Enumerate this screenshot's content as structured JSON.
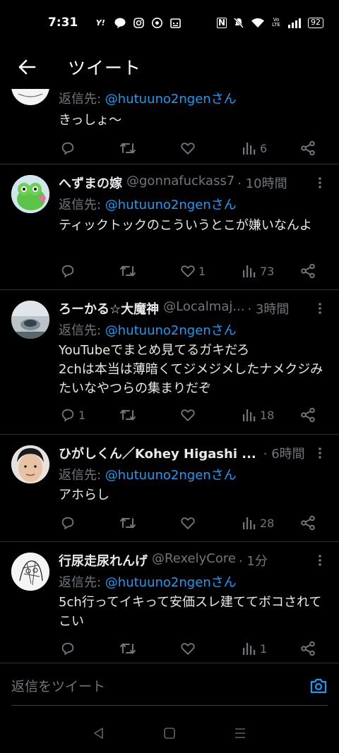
{
  "status_bar": {
    "time": "7:31",
    "battery": "92",
    "left_icons": [
      "yahoo-icon",
      "line-icon",
      "instagram-icon",
      "chrome-icon",
      "calendar-icon"
    ],
    "right_icons": [
      "nfc-icon",
      "mute-icon",
      "wifi-icon",
      "volte-icon",
      "signal-icon",
      "battery-icon"
    ]
  },
  "header": {
    "title": "ツイート"
  },
  "tweets": [
    {
      "name": "",
      "handle": "",
      "time": "",
      "reply_label": "返信先: ",
      "reply_mention": "@hutuuno2ngenさん",
      "text": "きっしょ〜",
      "replies": "",
      "retweets": "",
      "likes": "",
      "views": "6"
    },
    {
      "name": "へずまの嫁",
      "handle": "@gonnafuckass7",
      "time": "· 10時間",
      "reply_label": "返信先: ",
      "reply_mention": "@hutuuno2ngenさん",
      "text": "ティックトックのこういうとこが嫌いなんよ",
      "replies": "",
      "retweets": "",
      "likes": "1",
      "views": "73"
    },
    {
      "name": "ろーかる☆大魔神",
      "handle": "@Localmaj...",
      "time": "· 3時間",
      "reply_label": "返信先: ",
      "reply_mention": "@hutuuno2ngenさん",
      "text": "YouTubeでまとめ見てるガキだろ\n2chは本当は薄暗くてジメジメしたナメクジみたいなやつらの集まりだぞ",
      "replies": "1",
      "retweets": "",
      "likes": "",
      "views": "18"
    },
    {
      "name": "ひがしくん／Kohey Higashi ...",
      "handle": "",
      "time": "· 6時間",
      "reply_label": "返信先: ",
      "reply_mention": "@hutuuno2ngenさん",
      "text": "アホらし",
      "replies": "",
      "retweets": "",
      "likes": "",
      "views": "28"
    },
    {
      "name": "行尿走尿れんげ",
      "handle": "@RexelyCore",
      "time": "· 1分",
      "reply_label": "返信先: ",
      "reply_mention": "@hutuuno2ngenさん",
      "text": "5ch行ってイキって安価スレ建ててボコされてこい",
      "replies": "",
      "retweets": "",
      "likes": "",
      "views": "1"
    }
  ],
  "reply_bar": {
    "placeholder": "返信をツイート"
  },
  "colors": {
    "accent": "#1d9bf0",
    "muted": "#71767b",
    "background": "#000000",
    "divider": "#2f3336"
  }
}
